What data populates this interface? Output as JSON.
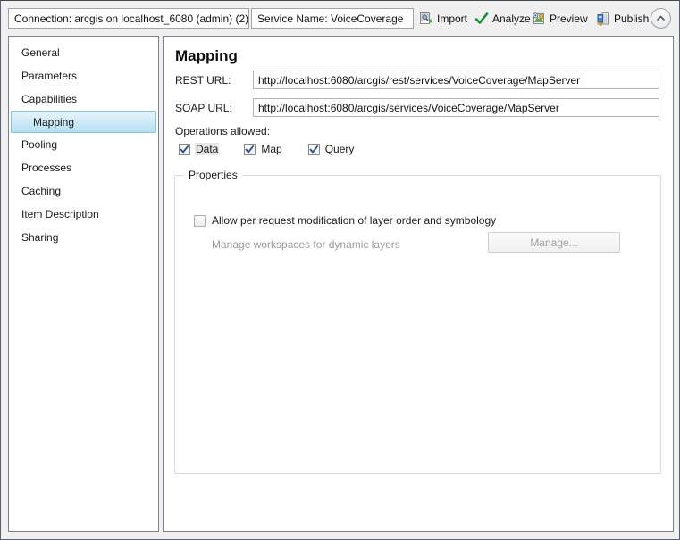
{
  "header": {
    "connection": "Connection: arcgis on localhost_6080 (admin) (2)",
    "service_name": "Service Name: VoiceCoverage",
    "buttons": [
      {
        "label": "Import",
        "icon": "import-icon"
      },
      {
        "label": "Analyze",
        "icon": "check-icon"
      },
      {
        "label": "Preview",
        "icon": "preview-icon"
      },
      {
        "label": "Publish",
        "icon": "publish-icon"
      }
    ],
    "collapse_icon": "chevron-up-icon"
  },
  "sidebar": {
    "items": [
      {
        "label": "General",
        "selected": false
      },
      {
        "label": "Parameters",
        "selected": false
      },
      {
        "label": "Capabilities",
        "selected": false
      },
      {
        "label": "Mapping",
        "selected": true
      },
      {
        "label": "Pooling",
        "selected": false
      },
      {
        "label": "Processes",
        "selected": false
      },
      {
        "label": "Caching",
        "selected": false
      },
      {
        "label": "Item Description",
        "selected": false
      },
      {
        "label": "Sharing",
        "selected": false
      }
    ]
  },
  "main": {
    "title": "Mapping",
    "rest_label": "REST URL:",
    "rest_url": "http://localhost:6080/arcgis/rest/services/VoiceCoverage/MapServer",
    "soap_label": "SOAP URL:",
    "soap_url": "http://localhost:6080/arcgis/services/VoiceCoverage/MapServer",
    "operations_label": "Operations allowed:",
    "operations": [
      {
        "label": "Data",
        "checked": true,
        "focused": true
      },
      {
        "label": "Map",
        "checked": true,
        "focused": false
      },
      {
        "label": "Query",
        "checked": true,
        "focused": false
      }
    ],
    "properties": {
      "title": "Properties",
      "allow_label": "Allow per request modification of layer order and symbology",
      "allow_checked": false,
      "manage_workspaces_label": "Manage workspaces for dynamic layers",
      "manage_button_label": "Manage...",
      "manage_button_enabled": false
    }
  },
  "colors": {
    "selection_blue": "#b6e0f5",
    "selection_border": "#82c4e4",
    "check_mark": "#2a4b8d",
    "analyze_check": "#168c2e",
    "panel_border": "#7b8190",
    "disabled_text": "#9a9a9a"
  }
}
